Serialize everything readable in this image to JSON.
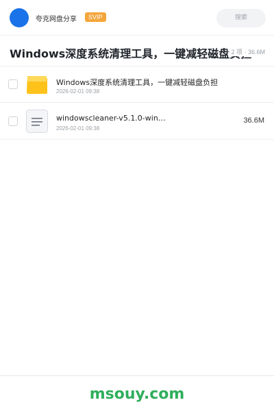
{
  "header": {
    "brand": "夸克网盘分享",
    "badge": "SVIP",
    "search_label": "搜索"
  },
  "share": {
    "title": "Windows深度系统清理工具，一键减轻磁盘负担",
    "meta": "2 项 · 36.6M"
  },
  "files": [
    {
      "icon": "folder-icon",
      "name": "Windows深度系统清理工具，一键减轻磁盘负担",
      "date": "2026-02-01 09:38",
      "size": ""
    },
    {
      "icon": "document-icon",
      "name": "windowscleaner-v5.1.0-win…",
      "date": "2026-02-01 09:38",
      "size": "36.6M"
    }
  ],
  "footer": {
    "watermark": "msouy.com"
  },
  "colors": {
    "accent": "#1a73e8",
    "svip": "#f4a63b",
    "folder": "#ffc21a",
    "watermark": "#2fae5c"
  }
}
